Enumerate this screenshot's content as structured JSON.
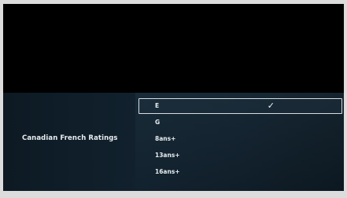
{
  "menu": {
    "title": "Canadian French Ratings",
    "options": [
      {
        "label": "E",
        "selected": true
      },
      {
        "label": "G",
        "selected": false
      },
      {
        "label": "8ans+",
        "selected": false
      },
      {
        "label": "13ans+",
        "selected": false
      },
      {
        "label": "16ans+",
        "selected": false
      }
    ],
    "check_icon": "✓"
  },
  "colors": {
    "screen_background": "#000000",
    "panel_background": "#11212d",
    "text": "#e9eef2",
    "selection_border": "#d8dde2"
  }
}
